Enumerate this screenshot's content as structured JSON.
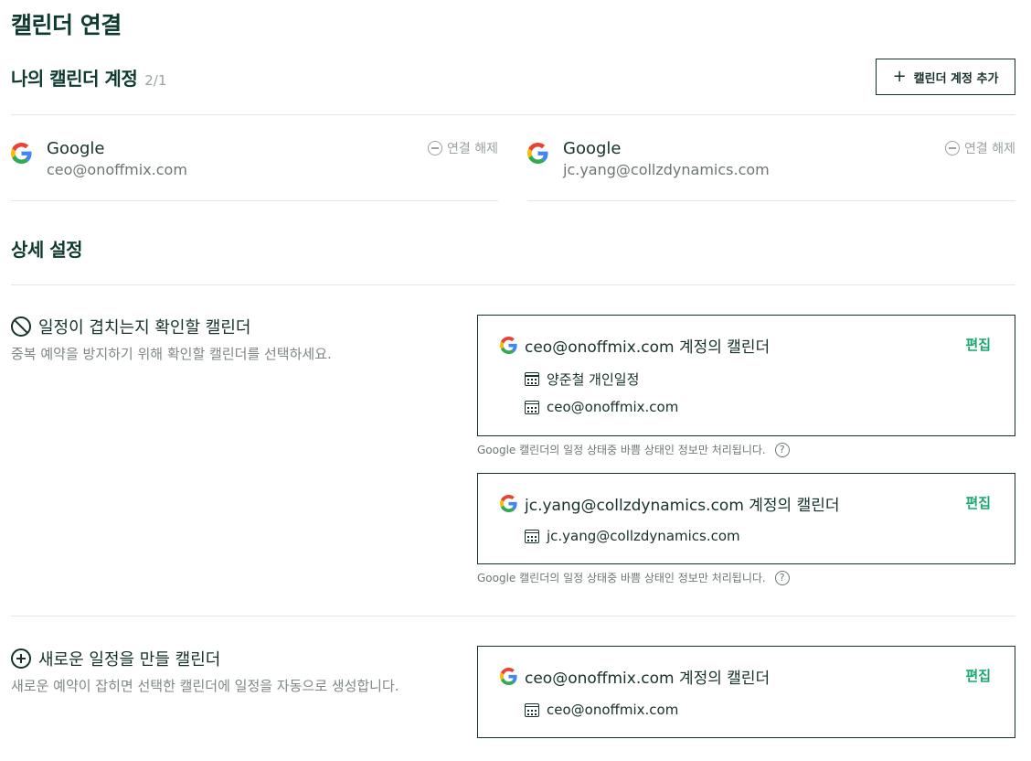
{
  "page_title": "캘린더 연결",
  "accounts_section": {
    "title": "나의 캘린더 계정",
    "count": "2/1",
    "add_button_label": "캘린더 계정 추가"
  },
  "accounts": [
    {
      "provider": "Google",
      "email": "ceo@onoffmix.com",
      "disconnect_label": "연결 해제"
    },
    {
      "provider": "Google",
      "email": "jc.yang@collzdynamics.com",
      "disconnect_label": "연결 해제"
    }
  ],
  "details_section": {
    "title": "상세 설정"
  },
  "conflict_setting": {
    "label": "일정이 겹치는지 확인할 캘린더",
    "description": "중복 예약을 방지하기 위해 확인할 캘린더를 선택하세요.",
    "boxes": [
      {
        "title": "ceo@onoffmix.com 계정의 캘린더",
        "edit_label": "편집",
        "items": [
          "양준철 개인일정",
          "ceo@onoffmix.com"
        ]
      },
      {
        "title": "jc.yang@collzdynamics.com 계정의 캘린더",
        "edit_label": "편집",
        "items": [
          "jc.yang@collzdynamics.com"
        ]
      }
    ],
    "note": "Google 캘린더의 일정 상태중 바쁨 상태인 정보만 처리됩니다."
  },
  "create_setting": {
    "label": "새로운 일정을 만들 캘린더",
    "description": "새로운 예약이 잡히면 선택한 캘린더에 일정을 자동으로 생성합니다.",
    "boxes": [
      {
        "title": "ceo@onoffmix.com 계정의 캘린더",
        "edit_label": "편집",
        "items": [
          "ceo@onoffmix.com"
        ]
      }
    ]
  },
  "colors": {
    "primary": "#16302b",
    "accent": "#1aa86f",
    "muted": "#9aa3a0"
  }
}
